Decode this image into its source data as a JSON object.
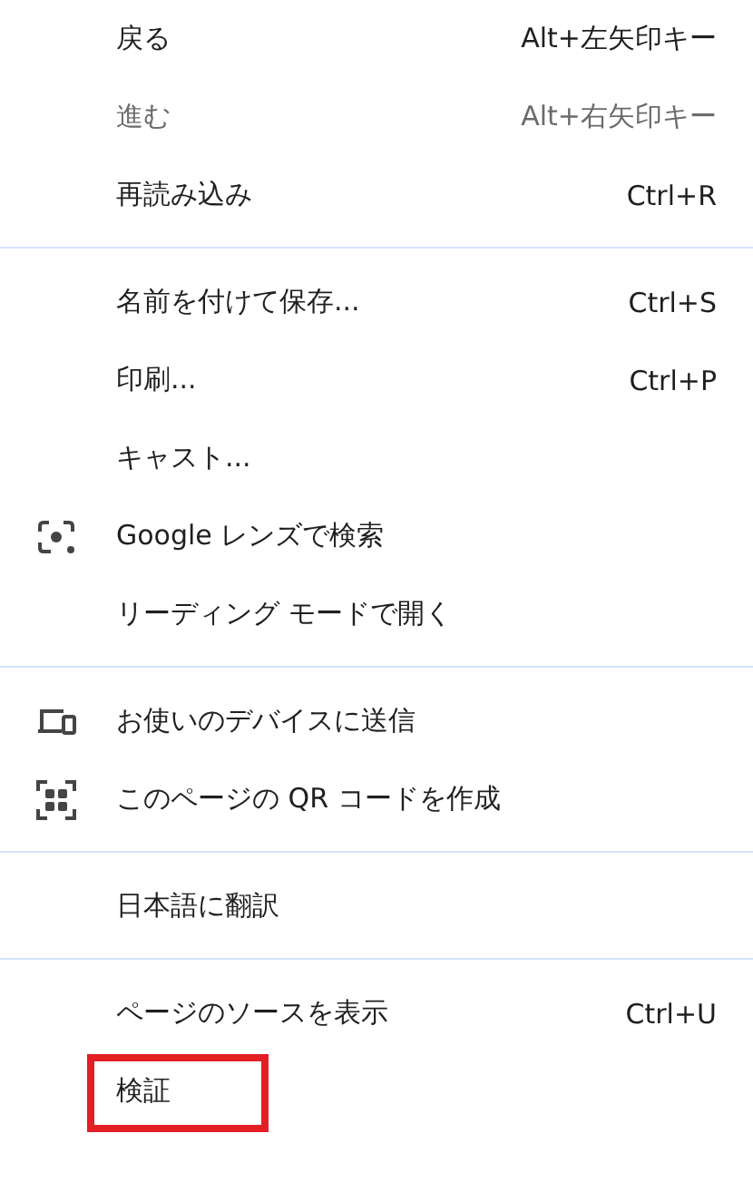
{
  "menu": {
    "sections": [
      {
        "items": [
          {
            "label": "戻る",
            "shortcut": "Alt+左矢印キー",
            "disabled": false
          },
          {
            "label": "進む",
            "shortcut": "Alt+右矢印キー",
            "disabled": true
          },
          {
            "label": "再読み込み",
            "shortcut": "Ctrl+R",
            "disabled": false
          }
        ]
      },
      {
        "items": [
          {
            "label": "名前を付けて保存...",
            "shortcut": "Ctrl+S",
            "disabled": false
          },
          {
            "label": "印刷...",
            "shortcut": "Ctrl+P",
            "disabled": false
          },
          {
            "label": "キャスト...",
            "disabled": false
          },
          {
            "label": "Google レンズで検索",
            "kind": "lens",
            "disabled": false
          },
          {
            "label": "リーディング モードで開く",
            "disabled": false
          }
        ]
      },
      {
        "items": [
          {
            "label": "お使いのデバイスに送信",
            "kind": "devices",
            "disabled": false
          },
          {
            "label": "このページの QR コードを作成",
            "kind": "qr",
            "disabled": false
          }
        ]
      },
      {
        "items": [
          {
            "label": "日本語に翻訳",
            "disabled": false
          }
        ]
      },
      {
        "items": [
          {
            "label": "ページのソースを表示",
            "shortcut": "Ctrl+U",
            "disabled": false
          },
          {
            "label": "検証",
            "disabled": false,
            "highlighted": true
          }
        ]
      }
    ]
  }
}
